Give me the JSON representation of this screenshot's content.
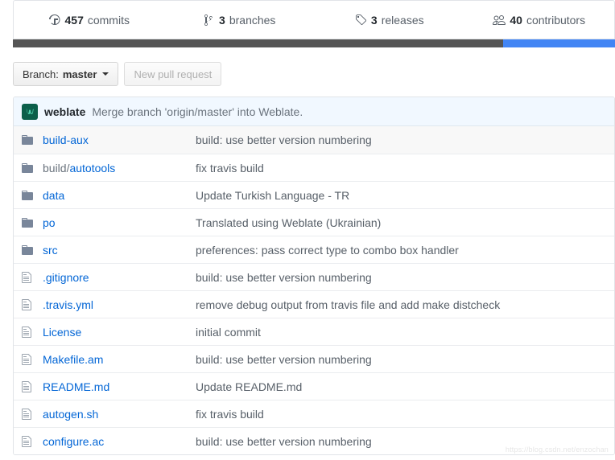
{
  "stats": [
    {
      "icon": "history-icon",
      "count": "457",
      "label": "commits",
      "name": "commits"
    },
    {
      "icon": "git-branch-icon",
      "count": "3",
      "label": "branches",
      "name": "branches"
    },
    {
      "icon": "tag-icon",
      "count": "3",
      "label": "releases",
      "name": "releases"
    },
    {
      "icon": "people-icon",
      "count": "40",
      "label": "contributors",
      "name": "contributors"
    }
  ],
  "language_bar": [
    {
      "name": "primary-language",
      "color": "#555555",
      "percent": 81.4
    },
    {
      "name": "secondary-language",
      "color": "#4285f4",
      "percent": 18.6
    }
  ],
  "toolbar": {
    "branch_prefix": "Branch:",
    "branch_name": "master",
    "new_pull_request_label": "New pull request"
  },
  "latest_commit": {
    "avatar_glyph": "ω",
    "author": "weblate",
    "message": "Merge branch 'origin/master' into Weblate."
  },
  "files": [
    {
      "type": "folder",
      "name": "build-aux",
      "prefix": "",
      "message": "build: use better version numbering"
    },
    {
      "type": "folder",
      "name": "autotools",
      "prefix": "build/",
      "message": "fix travis build"
    },
    {
      "type": "folder",
      "name": "data",
      "prefix": "",
      "message": "Update Turkish Language - TR"
    },
    {
      "type": "folder",
      "name": "po",
      "prefix": "",
      "message": "Translated using Weblate (Ukrainian)"
    },
    {
      "type": "folder",
      "name": "src",
      "prefix": "",
      "message": "preferences: pass correct type to combo box handler"
    },
    {
      "type": "file",
      "name": ".gitignore",
      "prefix": "",
      "message": "build: use better version numbering"
    },
    {
      "type": "file",
      "name": ".travis.yml",
      "prefix": "",
      "message": "remove debug output from travis file and add make distcheck"
    },
    {
      "type": "file",
      "name": "License",
      "prefix": "",
      "message": "initial commit"
    },
    {
      "type": "file",
      "name": "Makefile.am",
      "prefix": "",
      "message": "build: use better version numbering"
    },
    {
      "type": "file",
      "name": "README.md",
      "prefix": "",
      "message": "Update README.md"
    },
    {
      "type": "file",
      "name": "autogen.sh",
      "prefix": "",
      "message": "fix travis build"
    },
    {
      "type": "file",
      "name": "configure.ac",
      "prefix": "",
      "message": "build: use better version numbering"
    }
  ],
  "watermark": "https://blog.csdn.net/enzochan"
}
